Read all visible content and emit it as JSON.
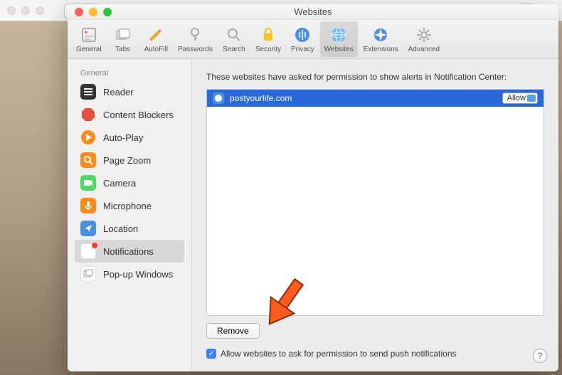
{
  "window": {
    "title": "Websites"
  },
  "toolbar": {
    "items": [
      {
        "label": "General"
      },
      {
        "label": "Tabs"
      },
      {
        "label": "AutoFill"
      },
      {
        "label": "Passwords"
      },
      {
        "label": "Search"
      },
      {
        "label": "Security"
      },
      {
        "label": "Privacy"
      },
      {
        "label": "Websites"
      },
      {
        "label": "Extensions"
      },
      {
        "label": "Advanced"
      }
    ]
  },
  "sidebar": {
    "header": "General",
    "items": [
      {
        "label": "Reader"
      },
      {
        "label": "Content Blockers"
      },
      {
        "label": "Auto-Play"
      },
      {
        "label": "Page Zoom"
      },
      {
        "label": "Camera"
      },
      {
        "label": "Microphone"
      },
      {
        "label": "Location"
      },
      {
        "label": "Notifications"
      },
      {
        "label": "Pop-up Windows"
      }
    ]
  },
  "main": {
    "description": "These websites have asked for permission to show alerts in Notification Center:",
    "sites": [
      {
        "domain": "postyourlife.com",
        "permission": "Allow"
      }
    ],
    "remove_label": "Remove",
    "checkbox_label": "Allow websites to ask for permission to send push notifications",
    "help_symbol": "?"
  }
}
